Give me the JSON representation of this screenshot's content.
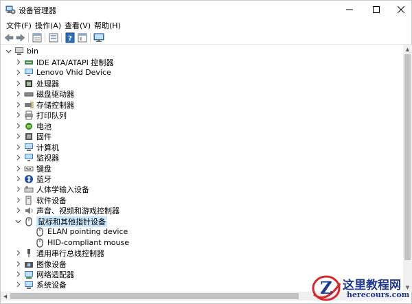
{
  "window": {
    "title": "设备管理器",
    "title_icon": "device-manager-icon"
  },
  "menu": [
    {
      "label": "文件(F)"
    },
    {
      "label": "操作(A)"
    },
    {
      "label": "查看(V)"
    },
    {
      "label": "帮助(H)"
    }
  ],
  "toolbar": [
    "back-arrow-icon",
    "forward-arrow-icon",
    "properties-icon",
    "view-icon",
    "help-icon",
    "console-icon",
    "monitor-icon"
  ],
  "tree": {
    "root": {
      "label": "bin",
      "expanded": true,
      "icon": "computer-icon"
    },
    "items": [
      {
        "label": "IDE ATA/ATAPI 控制器",
        "icon": "ide-controller-icon",
        "expanded": false
      },
      {
        "label": "Lenovo Vhid Device",
        "icon": "monitor-icon",
        "expanded": false
      },
      {
        "label": "处理器",
        "icon": "processor-icon",
        "expanded": false
      },
      {
        "label": "磁盘驱动器",
        "icon": "disk-drive-icon",
        "expanded": false
      },
      {
        "label": "存储控制器",
        "icon": "storage-controller-icon",
        "expanded": false
      },
      {
        "label": "打印队列",
        "icon": "printer-icon",
        "expanded": false
      },
      {
        "label": "电池",
        "icon": "battery-icon",
        "expanded": false
      },
      {
        "label": "固件",
        "icon": "firmware-icon",
        "expanded": false
      },
      {
        "label": "计算机",
        "icon": "computer-icon",
        "expanded": false
      },
      {
        "label": "监视器",
        "icon": "monitor-icon",
        "expanded": false
      },
      {
        "label": "键盘",
        "icon": "keyboard-icon",
        "expanded": false
      },
      {
        "label": "蓝牙",
        "icon": "bluetooth-icon",
        "expanded": false
      },
      {
        "label": "人体学输入设备",
        "icon": "hid-icon",
        "expanded": false
      },
      {
        "label": "软件设备",
        "icon": "software-device-icon",
        "expanded": false
      },
      {
        "label": "声音、视频和游戏控制器",
        "icon": "speaker-icon",
        "expanded": false
      },
      {
        "label": "鼠标和其他指针设备",
        "icon": "mouse-icon",
        "expanded": true,
        "selected": true,
        "children": [
          {
            "label": "ELAN pointing device",
            "icon": "mouse-icon"
          },
          {
            "label": "HID-compliant mouse",
            "icon": "mouse-icon"
          }
        ]
      },
      {
        "label": "通用串行总线控制器",
        "icon": "usb-icon",
        "expanded": false
      },
      {
        "label": "图像设备",
        "icon": "camera-icon",
        "expanded": false
      },
      {
        "label": "网络适配器",
        "icon": "network-adapter-icon",
        "expanded": false
      },
      {
        "label": "系统设备",
        "icon": "system-device-icon",
        "expanded": false
      }
    ]
  },
  "watermark": {
    "title": "这里教程网",
    "url": "herecours.com",
    "badge_letter": "Z"
  },
  "colors": {
    "selection": "#cce8ff",
    "watermark": "#1f3a93",
    "watermark_red": "#d8262b"
  }
}
